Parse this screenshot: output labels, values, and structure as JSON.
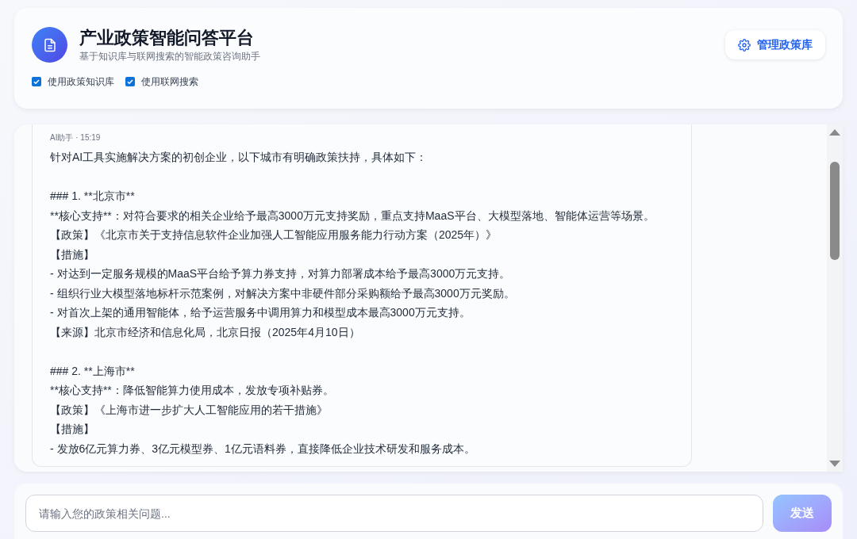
{
  "header": {
    "title": "产业政策智能问答平台",
    "subtitle": "基于知识库与联网搜索的智能政策咨询助手",
    "manage_button": "管理政策库",
    "options": [
      {
        "label": "使用政策知识库",
        "checked": true
      },
      {
        "label": "使用联网搜索",
        "checked": true
      }
    ]
  },
  "message": {
    "meta": "AI助手 · 15:19",
    "blocks": [
      [
        "针对AI工具实施解决方案的初创企业，以下城市有明确政策扶持，具体如下："
      ],
      [
        "### 1. **北京市**",
        "**核心支持**：对符合要求的相关企业给予最高3000万元支持奖励，重点支持MaaS平台、大模型落地、智能体运营等场景。",
        "【政策】《北京市关于支持信息软件企业加强人工智能应用服务能力行动方案（2025年）》",
        "【措施】",
        "- 对达到一定服务规模的MaaS平台给予算力券支持，对算力部署成本给予最高3000万元支持。",
        "- 组织行业大模型落地标杆示范案例，对解决方案中非硬件部分采购额给予最高3000万元奖励。",
        "- 对首次上架的通用智能体，给予运营服务中调用算力和模型成本最高3000万元支持。",
        "【来源】北京市经济和信息化局，北京日报（2025年4月10日）"
      ],
      [
        "### 2. **上海市**",
        "**核心支持**：降低智能算力使用成本，发放专项补贴券。",
        "【政策】《上海市进一步扩大人工智能应用的若干措施》",
        "【措施】",
        "- 发放6亿元算力券、3亿元模型券、1亿元语料券，直接降低企业技术研发和服务成本。"
      ]
    ]
  },
  "composer": {
    "placeholder": "请输入您的政策相关问题...",
    "send_button": "发送"
  }
}
